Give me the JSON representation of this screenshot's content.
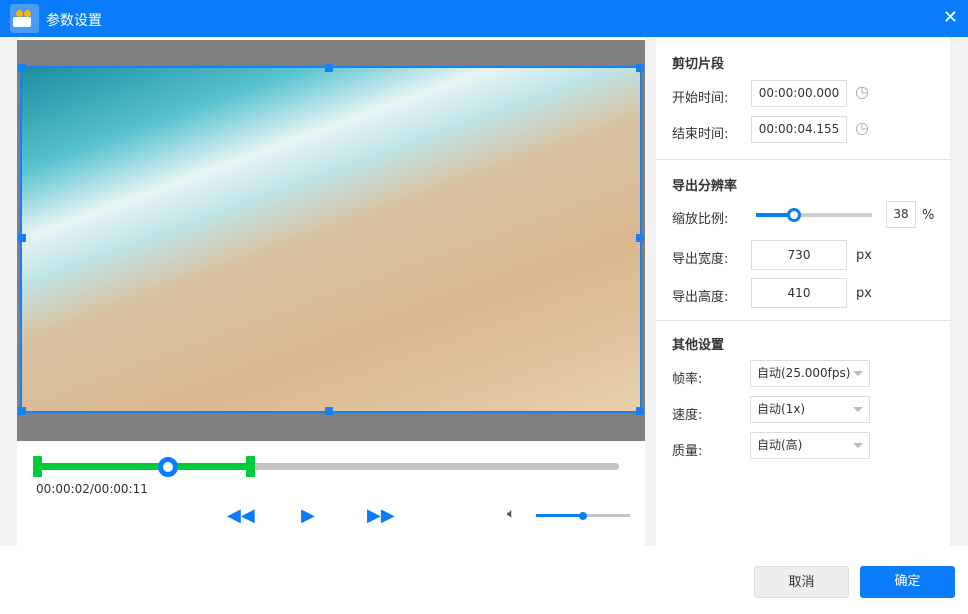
{
  "window": {
    "title": "参数设置",
    "close_icon": "close-icon"
  },
  "player": {
    "time": "00:00:02/00:00:11",
    "progress_fraction": 0.18,
    "trim_start_fraction": 0,
    "trim_end_fraction": 0.37,
    "volume_fraction": 0.5
  },
  "clip": {
    "heading": "剪切片段",
    "start_label": "开始时间:",
    "start_value": "00:00:00.000",
    "end_label": "结束时间:",
    "end_value": "00:00:04.155"
  },
  "resolution": {
    "heading": "导出分辨率",
    "scale_label": "缩放比例:",
    "scale_value": "38",
    "scale_unit": "%",
    "width_label": "导出宽度:",
    "width_value": "730",
    "height_label": "导出高度:",
    "height_value": "410",
    "px": "px"
  },
  "other": {
    "heading": "其他设置",
    "fps_label": "帧率:",
    "fps_value": "自动(25.000fps)",
    "speed_label": "速度:",
    "speed_value": "自动(1x)",
    "quality_label": "质量:",
    "quality_value": "自动(高)"
  },
  "footer": {
    "cancel": "取消",
    "ok": "确定"
  },
  "colors": {
    "accent": "#0a7cfa",
    "trim": "#00cc3a"
  }
}
